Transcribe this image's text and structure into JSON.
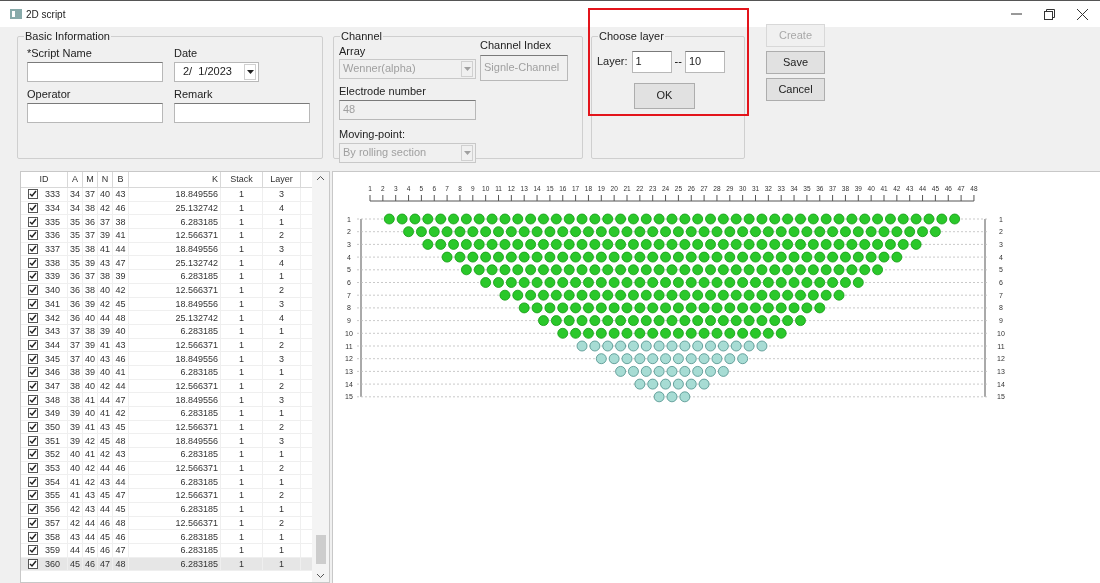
{
  "window": {
    "title": "2D script"
  },
  "basic_information": {
    "title": "Basic Information",
    "script_name": {
      "label": "*Script Name"
    },
    "date": {
      "label": "Date",
      "value": "2/  1/2023"
    },
    "operator": {
      "label": "Operator"
    },
    "remark": {
      "label": "Remark"
    }
  },
  "channel": {
    "title": "Channel",
    "array": {
      "label": "Array",
      "value": "Wenner(alpha)",
      "disabled": true
    },
    "channel_index": {
      "label": "Channel Index",
      "value": "Signle-Channel"
    },
    "electrode_number": {
      "label": "Electrode number",
      "value": "48"
    },
    "moving_point": {
      "label": "Moving-point:",
      "value": "By rolling section",
      "disabled": true
    }
  },
  "choose_layer": {
    "title": "Choose layer",
    "label": "Layer:",
    "from": "1",
    "separator": "--",
    "to": "10",
    "ok_button": "OK"
  },
  "buttons": [
    {
      "label": "Create",
      "disabled": true
    },
    {
      "label": "Save",
      "disabled": false
    },
    {
      "label": "Cancel",
      "disabled": false
    }
  ],
  "table": {
    "columns": [
      "ID",
      "A",
      "M",
      "N",
      "B",
      "K",
      "Stack",
      "Layer"
    ],
    "rows": [
      {
        "checked": true,
        "selected": false,
        "cells": [
          "333",
          "34",
          "37",
          "40",
          "43",
          "18.849556",
          "1",
          "3"
        ]
      },
      {
        "checked": true,
        "selected": false,
        "cells": [
          "334",
          "34",
          "38",
          "42",
          "46",
          "25.132742",
          "1",
          "4"
        ]
      },
      {
        "checked": true,
        "selected": false,
        "cells": [
          "335",
          "35",
          "36",
          "37",
          "38",
          "6.283185",
          "1",
          "1"
        ]
      },
      {
        "checked": true,
        "selected": false,
        "cells": [
          "336",
          "35",
          "37",
          "39",
          "41",
          "12.566371",
          "1",
          "2"
        ]
      },
      {
        "checked": true,
        "selected": false,
        "cells": [
          "337",
          "35",
          "38",
          "41",
          "44",
          "18.849556",
          "1",
          "3"
        ]
      },
      {
        "checked": true,
        "selected": false,
        "cells": [
          "338",
          "35",
          "39",
          "43",
          "47",
          "25.132742",
          "1",
          "4"
        ]
      },
      {
        "checked": true,
        "selected": false,
        "cells": [
          "339",
          "36",
          "37",
          "38",
          "39",
          "6.283185",
          "1",
          "1"
        ]
      },
      {
        "checked": true,
        "selected": false,
        "cells": [
          "340",
          "36",
          "38",
          "40",
          "42",
          "12.566371",
          "1",
          "2"
        ]
      },
      {
        "checked": true,
        "selected": false,
        "cells": [
          "341",
          "36",
          "39",
          "42",
          "45",
          "18.849556",
          "1",
          "3"
        ]
      },
      {
        "checked": true,
        "selected": false,
        "cells": [
          "342",
          "36",
          "40",
          "44",
          "48",
          "25.132742",
          "1",
          "4"
        ]
      },
      {
        "checked": true,
        "selected": false,
        "cells": [
          "343",
          "37",
          "38",
          "39",
          "40",
          "6.283185",
          "1",
          "1"
        ]
      },
      {
        "checked": true,
        "selected": false,
        "cells": [
          "344",
          "37",
          "39",
          "41",
          "43",
          "12.566371",
          "1",
          "2"
        ]
      },
      {
        "checked": true,
        "selected": false,
        "cells": [
          "345",
          "37",
          "40",
          "43",
          "46",
          "18.849556",
          "1",
          "3"
        ]
      },
      {
        "checked": true,
        "selected": false,
        "cells": [
          "346",
          "38",
          "39",
          "40",
          "41",
          "6.283185",
          "1",
          "1"
        ]
      },
      {
        "checked": true,
        "selected": false,
        "cells": [
          "347",
          "38",
          "40",
          "42",
          "44",
          "12.566371",
          "1",
          "2"
        ]
      },
      {
        "checked": true,
        "selected": false,
        "cells": [
          "348",
          "38",
          "41",
          "44",
          "47",
          "18.849556",
          "1",
          "3"
        ]
      },
      {
        "checked": true,
        "selected": false,
        "cells": [
          "349",
          "39",
          "40",
          "41",
          "42",
          "6.283185",
          "1",
          "1"
        ]
      },
      {
        "checked": true,
        "selected": false,
        "cells": [
          "350",
          "39",
          "41",
          "43",
          "45",
          "12.566371",
          "1",
          "2"
        ]
      },
      {
        "checked": true,
        "selected": false,
        "cells": [
          "351",
          "39",
          "42",
          "45",
          "48",
          "18.849556",
          "1",
          "3"
        ]
      },
      {
        "checked": true,
        "selected": false,
        "cells": [
          "352",
          "40",
          "41",
          "42",
          "43",
          "6.283185",
          "1",
          "1"
        ]
      },
      {
        "checked": true,
        "selected": false,
        "cells": [
          "353",
          "40",
          "42",
          "44",
          "46",
          "12.566371",
          "1",
          "2"
        ]
      },
      {
        "checked": true,
        "selected": false,
        "cells": [
          "354",
          "41",
          "42",
          "43",
          "44",
          "6.283185",
          "1",
          "1"
        ]
      },
      {
        "checked": true,
        "selected": false,
        "cells": [
          "355",
          "41",
          "43",
          "45",
          "47",
          "12.566371",
          "1",
          "2"
        ]
      },
      {
        "checked": true,
        "selected": false,
        "cells": [
          "356",
          "42",
          "43",
          "44",
          "45",
          "6.283185",
          "1",
          "1"
        ]
      },
      {
        "checked": true,
        "selected": false,
        "cells": [
          "357",
          "42",
          "44",
          "46",
          "48",
          "12.566371",
          "1",
          "2"
        ]
      },
      {
        "checked": true,
        "selected": false,
        "cells": [
          "358",
          "43",
          "44",
          "45",
          "46",
          "6.283185",
          "1",
          "1"
        ]
      },
      {
        "checked": true,
        "selected": false,
        "cells": [
          "359",
          "44",
          "45",
          "46",
          "47",
          "6.283185",
          "1",
          "1"
        ]
      },
      {
        "checked": true,
        "selected": true,
        "cells": [
          "360",
          "45",
          "46",
          "47",
          "48",
          "6.283185",
          "1",
          "1"
        ]
      }
    ]
  },
  "pseudo_section": {
    "electrodes": [
      "1",
      "2",
      "3",
      "4",
      "5",
      "6",
      "7",
      "8",
      "9",
      "10",
      "11",
      "12",
      "13",
      "14",
      "15",
      "16",
      "17",
      "18",
      "19",
      "20",
      "21",
      "22",
      "23",
      "24",
      "25",
      "26",
      "27",
      "28",
      "29",
      "30",
      "31",
      "32",
      "33",
      "34",
      "35",
      "36",
      "37",
      "38",
      "39",
      "40",
      "41",
      "42",
      "43",
      "44",
      "45",
      "46",
      "47",
      "48"
    ],
    "layers": [
      {
        "label": "1",
        "right_label": "1",
        "selected": true
      },
      {
        "label": "2",
        "right_label": "2",
        "selected": true
      },
      {
        "label": "3",
        "right_label": "3",
        "selected": true
      },
      {
        "label": "4",
        "right_label": "4",
        "selected": true
      },
      {
        "label": "5",
        "right_label": "5",
        "selected": true
      },
      {
        "label": "6",
        "right_label": "6",
        "selected": true
      },
      {
        "label": "7",
        "right_label": "7",
        "selected": true
      },
      {
        "label": "8",
        "right_label": "8",
        "selected": true
      },
      {
        "label": "9",
        "right_label": "9",
        "selected": true
      },
      {
        "label": "10",
        "right_label": "10",
        "selected": true
      },
      {
        "label": "11",
        "right_label": "11",
        "selected": false
      },
      {
        "label": "12",
        "right_label": "12",
        "selected": false
      },
      {
        "label": "13",
        "right_label": "13",
        "selected": false
      },
      {
        "label": "14",
        "right_label": "14",
        "selected": false
      },
      {
        "label": "15",
        "right_label": "15",
        "selected": false
      }
    ]
  }
}
